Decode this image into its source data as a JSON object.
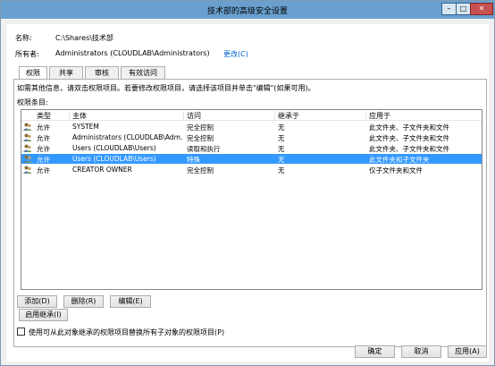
{
  "window": {
    "title": "技术部的高级安全设置",
    "controls": {
      "minimize": "–",
      "maximize": "□",
      "close": "✕"
    }
  },
  "info": {
    "name_label": "名称:",
    "name_value": "C:\\Shares\\技术部",
    "owner_label": "所有者:",
    "owner_value": "Administrators (CLOUDLAB\\Administrators)",
    "change_link": "更改(C)"
  },
  "tabs": [
    {
      "label": "权限",
      "active": true
    },
    {
      "label": "共享",
      "active": false
    },
    {
      "label": "审核",
      "active": false
    },
    {
      "label": "有效访问",
      "active": false
    }
  ],
  "permissions": {
    "instructions": "如需其他信息，请双击权限项目。若要修改权限项目，请选择该项目并单击\"编辑\"(如果可用)。",
    "entries_label": "权限条目:",
    "columns": [
      "类型",
      "主体",
      "访问",
      "继承于",
      "应用于"
    ],
    "rows": [
      {
        "type": "允许",
        "principal": "SYSTEM",
        "access": "完全控制",
        "inherited": "无",
        "applies": "此文件夹、子文件夹和文件",
        "selected": false
      },
      {
        "type": "允许",
        "principal": "Administrators (CLOUDLAB\\Adm...",
        "access": "完全控制",
        "inherited": "无",
        "applies": "此文件夹、子文件夹和文件",
        "selected": false
      },
      {
        "type": "允许",
        "principal": "Users (CLOUDLAB\\Users)",
        "access": "读取和执行",
        "inherited": "无",
        "applies": "此文件夹、子文件夹和文件",
        "selected": false
      },
      {
        "type": "允许",
        "principal": "Users (CLOUDLAB\\Users)",
        "access": "特殊",
        "inherited": "无",
        "applies": "此文件夹和子文件夹",
        "selected": true
      },
      {
        "type": "允许",
        "principal": "CREATOR OWNER",
        "access": "完全控制",
        "inherited": "无",
        "applies": "仅子文件夹和文件",
        "selected": false
      }
    ]
  },
  "buttons": {
    "add": "添加(D)",
    "remove": "删除(R)",
    "edit": "编辑(E)",
    "enable_inheritance": "启用继承(I)",
    "ok": "确定",
    "cancel": "取消",
    "apply": "应用(A)"
  },
  "replace_checkbox": {
    "label": "使用可从此对象继承的权限项目替换所有子对象的权限项目(P)",
    "checked": false
  },
  "colors": {
    "titlebar": "#6aa0cf",
    "selection": "#3399ff",
    "link": "#0066cc"
  }
}
